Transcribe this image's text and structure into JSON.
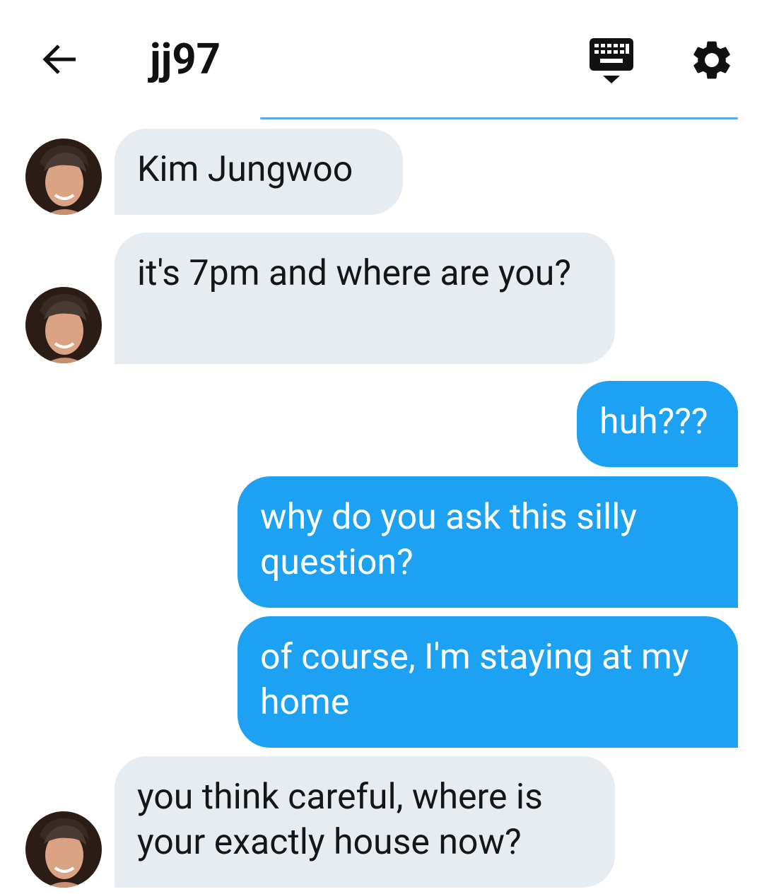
{
  "header": {
    "title": "jj97"
  },
  "messages": [
    {
      "text": "Kim Jungwoo"
    },
    {
      "text": "it's 7pm and where are you?"
    },
    {
      "text": "huh???"
    },
    {
      "text": "why do you ask this silly question?"
    },
    {
      "text": "of course, I'm staying at my home"
    },
    {
      "text": "you think careful, where is your exactly house now?"
    }
  ],
  "icons": {
    "back": "arrow-left-icon",
    "keyboard": "keyboard-icon",
    "settings": "gear-icon"
  },
  "colors": {
    "incoming_bubble": "#e6ecf0",
    "outgoing_bubble": "#1da1f2",
    "accent_line": "#5aa9ea"
  }
}
